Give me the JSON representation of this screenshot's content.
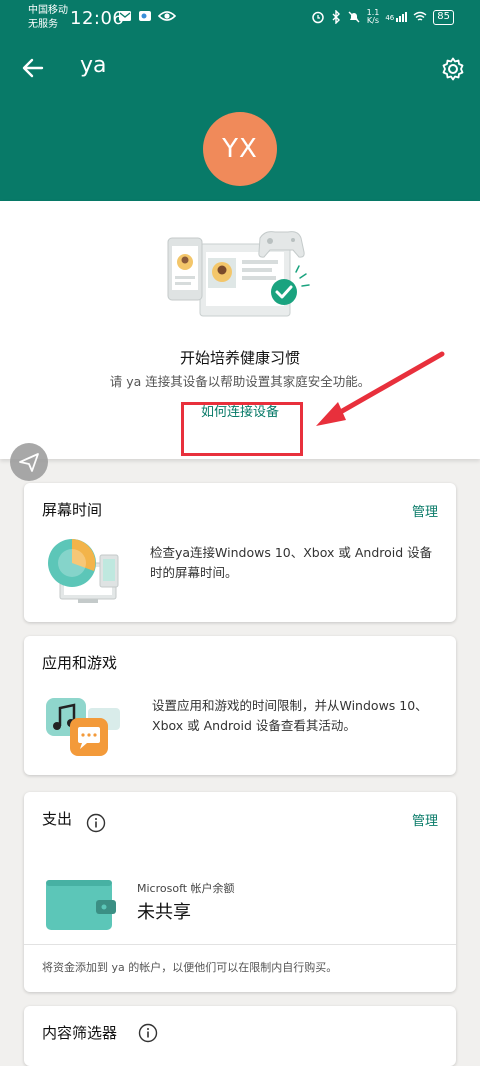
{
  "status_bar": {
    "carrier_line1": "中国移动",
    "carrier_line2": "无服务",
    "time": "12:06",
    "net_speed_value": "1.1",
    "net_speed_unit": "K/s",
    "signal_label": "46",
    "battery": "85"
  },
  "header": {
    "title": "ya",
    "avatar_initials": "YX",
    "back_icon": "arrow-left-icon",
    "settings_icon": "gear-icon"
  },
  "hero": {
    "title": "开始培养健康习惯",
    "subtitle": "请 ya 连接其设备以帮助设置其家庭安全功能。",
    "link": "如何连接设备"
  },
  "cards": {
    "screen_time": {
      "title": "屏幕时间",
      "manage": "管理",
      "description": "检查ya连接Windows 10、Xbox 或 Android 设备时的屏幕时间。"
    },
    "apps_games": {
      "title": "应用和游戏",
      "description": "设置应用和游戏的时间限制，并从Windows 10、Xbox 或 Android 设备查看其活动。"
    },
    "spending": {
      "title": "支出",
      "manage": "管理",
      "balance_label": "Microsoft 帐户余额",
      "balance_value": "未共享",
      "footer": "将资金添加到 ya 的帐户，以便他们可以在限制内自行购买。"
    },
    "content_filter": {
      "title": "内容筛选器"
    }
  },
  "colors": {
    "brand_teal": "#087a68",
    "avatar_orange": "#f08a5a",
    "annotation_red": "#e8303c"
  }
}
